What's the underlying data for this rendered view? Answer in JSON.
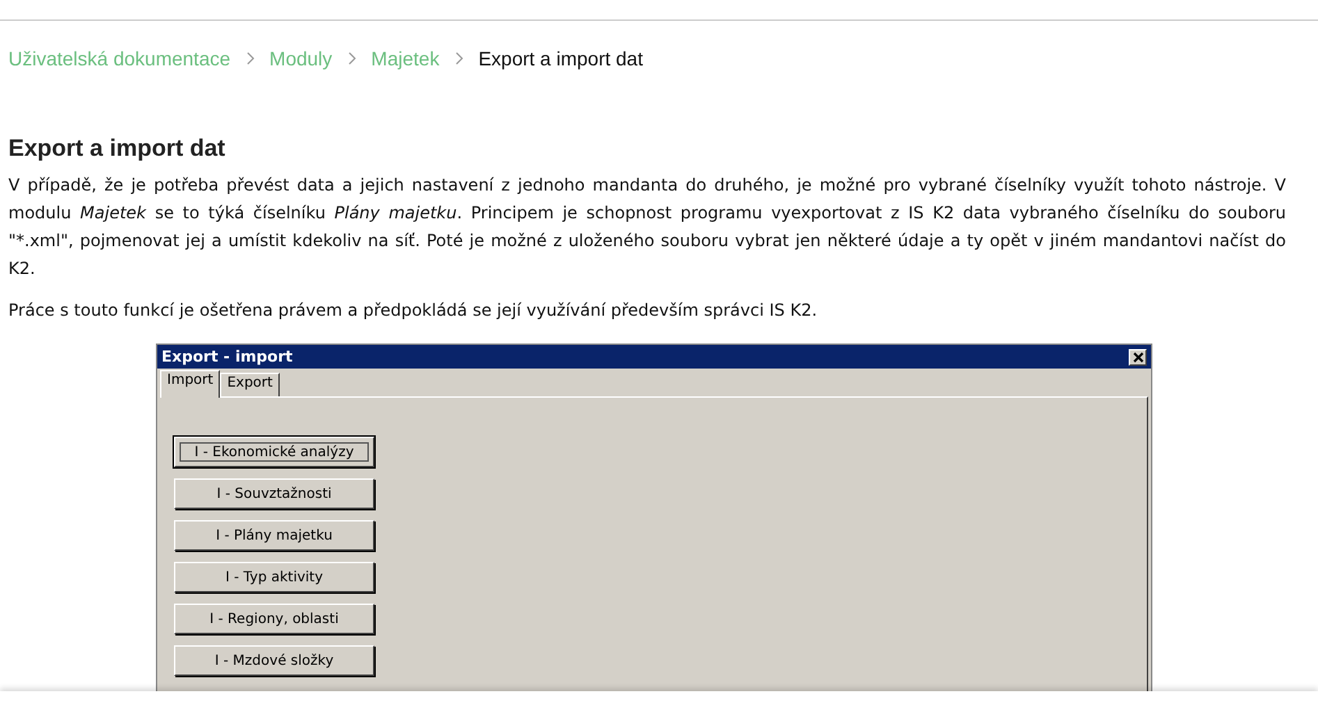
{
  "breadcrumb": [
    {
      "label": "Uživatelská dokumentace",
      "current": false
    },
    {
      "label": "Moduly",
      "current": false
    },
    {
      "label": "Majetek",
      "current": false
    },
    {
      "label": "Export a import dat",
      "current": true
    }
  ],
  "heading": "Export a import dat",
  "paragraphs": [
    "V případě, že je potřeba převést data a jejich nastavení z jednoho mandanta do druhého, je možné pro vybrané číselníky využít tohoto nástroje. V modulu *Majetek* se to týká číselníku *Plány majetku*. Principem je schopnost programu vyexportovat z IS K2 data vybraného číselníku do souboru \"*.xml\", pojmenovat jej a umístit kdekoliv na síť. Poté je možné z uloženého souboru vybrat jen některé údaje a ty opět v jiném mandantovi načíst do K2.",
    "Práce s touto funkcí je ošetřena právem a předpokládá se její využívání především správci IS K2."
  ],
  "dialog": {
    "title": "Export - import",
    "tabs": [
      {
        "label": "Import",
        "selected": true
      },
      {
        "label": "Export",
        "selected": false
      }
    ],
    "buttons": [
      {
        "label": "I - Ekonomické analýzy",
        "focused": true
      },
      {
        "label": "I - Souvztažnosti",
        "focused": false
      },
      {
        "label": "I - Plány majetku",
        "focused": false
      },
      {
        "label": "I - Typ aktivity",
        "focused": false
      },
      {
        "label": "I - Regiony, oblasti",
        "focused": false
      },
      {
        "label": "I - Mzdové složky",
        "focused": false
      }
    ]
  }
}
